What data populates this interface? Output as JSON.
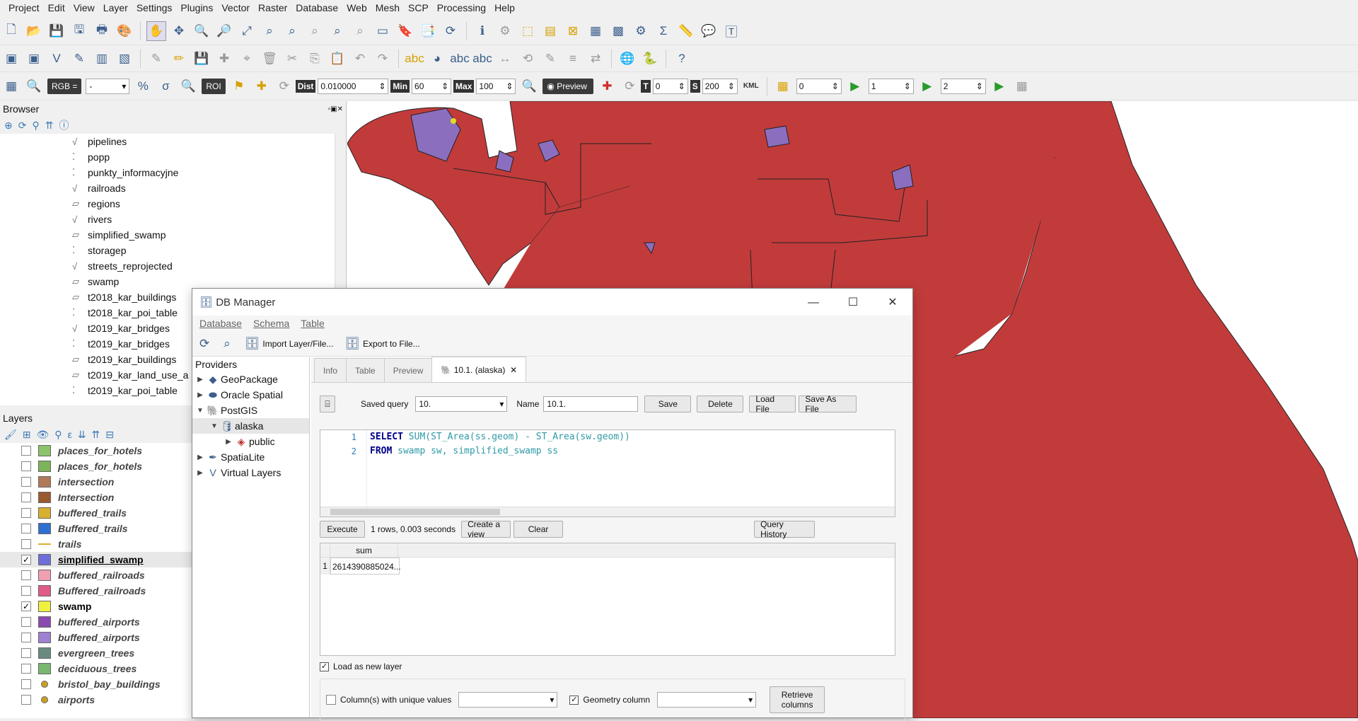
{
  "menu": [
    "Project",
    "Edit",
    "View",
    "Layer",
    "Settings",
    "Plugins",
    "Vector",
    "Raster",
    "Database",
    "Web",
    "Mesh",
    "SCP",
    "Processing",
    "Help"
  ],
  "toolbar3": {
    "rgb_label": "RGB =",
    "rgb_value": "-",
    "roi_label": "ROI",
    "dist_label": "Dist",
    "dist_value": "0.010000",
    "min_label": "Min",
    "min_value": "60",
    "max_label": "Max",
    "max_value": "100",
    "preview_label": "Preview",
    "t_label": "T",
    "t_value": "0",
    "s_label": "S",
    "s_value": "200",
    "kml_label": "KML",
    "band_values": [
      "0",
      "1",
      "2"
    ]
  },
  "browser": {
    "title": "Browser",
    "items": [
      {
        "label": "pipelines",
        "icon": "line-icon"
      },
      {
        "label": "popp",
        "icon": "point-icon"
      },
      {
        "label": "punkty_informacyjne",
        "icon": "point-icon"
      },
      {
        "label": "railroads",
        "icon": "line-icon"
      },
      {
        "label": "regions",
        "icon": "polygon-icon"
      },
      {
        "label": "rivers",
        "icon": "line-icon"
      },
      {
        "label": "simplified_swamp",
        "icon": "polygon-icon"
      },
      {
        "label": "storagep",
        "icon": "point-icon"
      },
      {
        "label": "streets_reprojected",
        "icon": "line-icon"
      },
      {
        "label": "swamp",
        "icon": "polygon-icon"
      },
      {
        "label": "t2018_kar_buildings",
        "icon": "polygon-icon"
      },
      {
        "label": "t2018_kar_poi_table",
        "icon": "point-icon"
      },
      {
        "label": "t2019_kar_bridges",
        "icon": "line-icon"
      },
      {
        "label": "t2019_kar_bridges",
        "icon": "point-icon"
      },
      {
        "label": "t2019_kar_buildings",
        "icon": "polygon-icon"
      },
      {
        "label": "t2019_kar_land_use_a",
        "icon": "polygon-icon"
      },
      {
        "label": "t2019_kar_poi_table",
        "icon": "point-icon"
      }
    ]
  },
  "layers": {
    "title": "Layers",
    "items": [
      {
        "label": "places_for_hotels",
        "checked": false,
        "color": "#8bc46a"
      },
      {
        "label": "places_for_hotels",
        "checked": false,
        "color": "#7cb45a"
      },
      {
        "label": "intersection",
        "checked": false,
        "color": "#b07a5a"
      },
      {
        "label": "Intersection",
        "checked": false,
        "color": "#9a5a30"
      },
      {
        "label": "buffered_trails",
        "checked": false,
        "color": "#d8b030"
      },
      {
        "label": "Buffered_trails",
        "checked": false,
        "color": "#2f6fd0"
      },
      {
        "label": "trails",
        "checked": false,
        "color": "line"
      },
      {
        "label": "simplified_swamp",
        "checked": true,
        "color": "#6e6ed8"
      },
      {
        "label": "buffered_railroads",
        "checked": false,
        "color": "#f0a0b0"
      },
      {
        "label": "Buffered_railroads",
        "checked": false,
        "color": "#e05a8a"
      },
      {
        "label": "swamp",
        "checked": true,
        "color": "#f0f040"
      },
      {
        "label": "buffered_airports",
        "checked": false,
        "color": "#8a4ab0"
      },
      {
        "label": "buffered_airports",
        "checked": false,
        "color": "#a080d0"
      },
      {
        "label": "evergreen_trees",
        "checked": false,
        "color": "#6a8a80"
      },
      {
        "label": "deciduous_trees",
        "checked": false,
        "color": "#7ab870"
      },
      {
        "label": "bristol_bay_buildings",
        "checked": false,
        "color": "dot"
      },
      {
        "label": "airports",
        "checked": false,
        "color": "dot"
      }
    ]
  },
  "dbmanager": {
    "title": "DB Manager",
    "menu": [
      "Database",
      "Schema",
      "Table"
    ],
    "import_label": "Import Layer/File...",
    "export_label": "Export to File...",
    "providers_title": "Providers",
    "providers": [
      {
        "label": "GeoPackage",
        "level": 0,
        "arrow": "▶"
      },
      {
        "label": "Oracle Spatial",
        "level": 0,
        "arrow": "▶"
      },
      {
        "label": "PostGIS",
        "level": 0,
        "arrow": "▼"
      },
      {
        "label": "alaska",
        "level": 1,
        "arrow": "▼"
      },
      {
        "label": "public",
        "level": 2,
        "arrow": "▶"
      },
      {
        "label": "SpatiaLite",
        "level": 0,
        "arrow": "▶"
      },
      {
        "label": "Virtual Layers",
        "level": 0,
        "arrow": "▶"
      }
    ],
    "tabs": [
      "Info",
      "Table",
      "Preview",
      "10.1. (alaska)"
    ],
    "saved_query_label": "Saved query",
    "saved_query_value": "10.",
    "name_label": "Name",
    "name_value": "10.1.",
    "save_label": "Save",
    "delete_label": "Delete",
    "load_file_label": "Load File",
    "save_as_file_label": "Save As File",
    "sql_line1_kw": "SELECT",
    "sql_line1_rest": " SUM(ST_Area(ss.geom) - ST_Area(sw.geom))",
    "sql_line2_kw": "FROM",
    "sql_line2_rest": " swamp sw, simplified_swamp ss",
    "execute_label": "Execute",
    "status": "1 rows, 0.003 seconds",
    "create_view_label": "Create a view",
    "clear_label": "Clear",
    "query_history_label": "Query History",
    "result_header": "sum",
    "result_row_num": "1",
    "result_value": "2614390885024...",
    "load_layer_label": "Load as new layer",
    "unique_cols_label": "Column(s) with unique values",
    "geometry_col_label": "Geometry column",
    "retrieve_label": "Retrieve columns"
  }
}
